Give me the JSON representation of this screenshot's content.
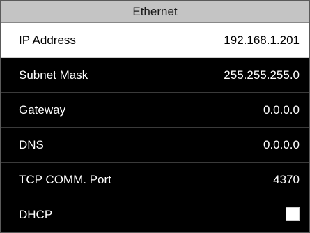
{
  "title": "Ethernet",
  "rows": [
    {
      "label": "IP Address",
      "value": "192.168.1.201",
      "selected": true
    },
    {
      "label": "Subnet Mask",
      "value": "255.255.255.0",
      "selected": false
    },
    {
      "label": "Gateway",
      "value": "0.0.0.0",
      "selected": false
    },
    {
      "label": "DNS",
      "value": "0.0.0.0",
      "selected": false
    },
    {
      "label": "TCP COMM. Port",
      "value": "4370",
      "selected": false
    },
    {
      "label": "DHCP",
      "checked": false,
      "selected": false
    }
  ],
  "colors": {
    "title_background": "#c4c4c4",
    "selected_background": "#ffffff",
    "background": "#000000",
    "text": "#ffffff"
  }
}
